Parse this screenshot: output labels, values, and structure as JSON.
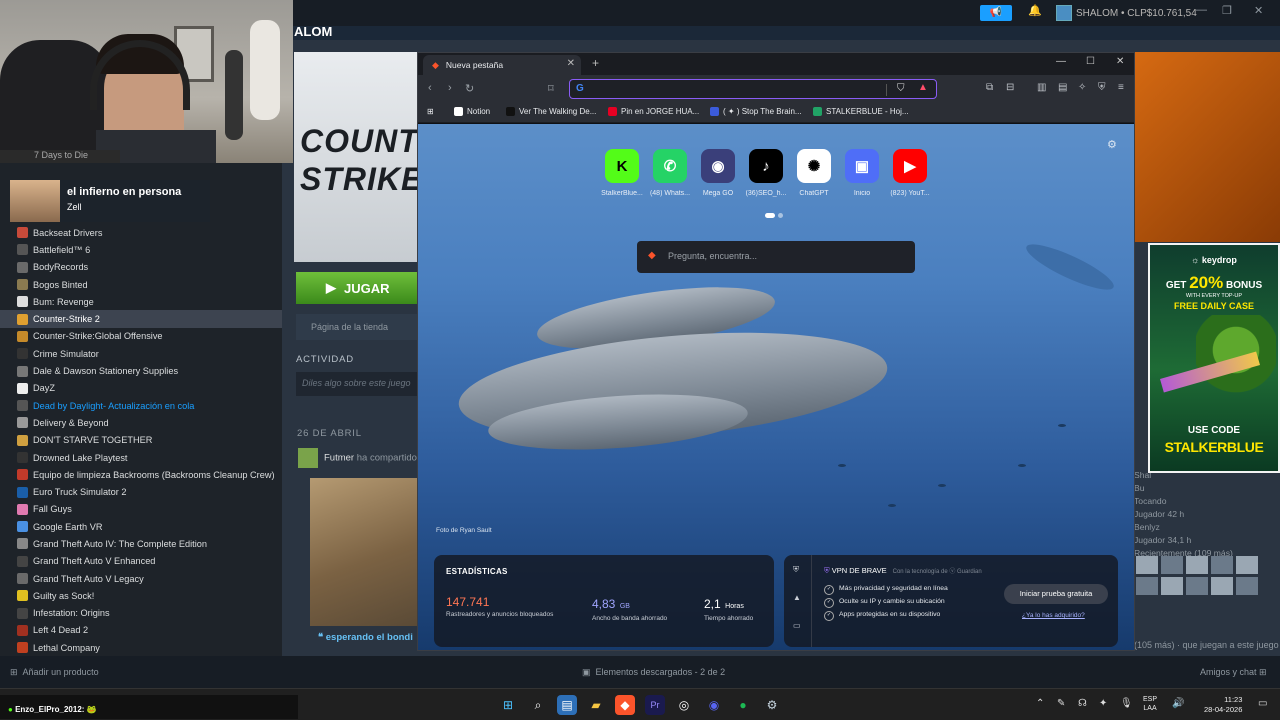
{
  "steam": {
    "game_title": "ALOM",
    "account": "SHALOM • CLP$10.761,54",
    "hero_logo": "COUNTER-STRIKE",
    "play_label": "JUGAR",
    "store_page": "Página de la tienda",
    "activity_heading": "ACTIVIDAD",
    "activity_placeholder": "Diles algo sobre este juego",
    "date_heading": "26 DE ABRIL",
    "feed_user": "Futmer",
    "feed_text": "ha compartido",
    "waiting_text": "esperando el bondi",
    "games": [
      {
        "name": "Backseat Drivers",
        "color": "#c74a3a"
      },
      {
        "name": "Battlefield™ 6",
        "color": "#555"
      },
      {
        "name": "BodyRecords",
        "color": "#6a6a6a"
      },
      {
        "name": "Bogos Binted",
        "color": "#8a7a50"
      },
      {
        "name": "Bum: Revenge",
        "color": "#ddd"
      },
      {
        "name": "Counter-Strike 2",
        "color": "#e0a030",
        "selected": true
      },
      {
        "name": "Counter-Strike:Global Offensive",
        "color": "#c58a2a"
      },
      {
        "name": "Crime Simulator",
        "color": "#333"
      },
      {
        "name": "Dale & Dawson Stationery Supplies",
        "color": "#777"
      },
      {
        "name": "DayZ",
        "color": "#eee"
      },
      {
        "name": "Dead by Daylight",
        "color": "#555",
        "update": " - Actualización en cola"
      },
      {
        "name": "Delivery & Beyond",
        "color": "#999"
      },
      {
        "name": "DON'T STARVE TOGETHER",
        "color": "#d0a040"
      },
      {
        "name": "Drowned Lake Playtest",
        "color": "#333"
      },
      {
        "name": "Equipo de limpieza Backrooms (Backrooms Cleanup Crew)",
        "color": "#c23a2a"
      },
      {
        "name": "Euro Truck Simulator 2",
        "color": "#1a5ea8"
      },
      {
        "name": "Fall Guys",
        "color": "#e07ab0"
      },
      {
        "name": "Google Earth VR",
        "color": "#4a90e2"
      },
      {
        "name": "Grand Theft Auto IV: The Complete Edition",
        "color": "#888"
      },
      {
        "name": "Grand Theft Auto V Enhanced",
        "color": "#444"
      },
      {
        "name": "Grand Theft Auto V Legacy",
        "color": "#6a6a6a"
      },
      {
        "name": "Guilty as Sock!",
        "color": "#e0c020"
      },
      {
        "name": "Infestation: Origins",
        "color": "#444"
      },
      {
        "name": "Left 4 Dead 2",
        "color": "#a03020"
      },
      {
        "name": "Lethal Company",
        "color": "#c04020"
      }
    ],
    "right_col": [
      "Shal",
      "Bu",
      "Tocando",
      "Jugador 42 h",
      "Benlyz",
      "Jugador 34,1 h",
      "Recientemente (109 más)"
    ],
    "recent_more": "(105 más)",
    "playing_text": "que juegan a este juego",
    "add_product": "Añadir un producto",
    "downloads": "Elementos descargados - 2 de 2",
    "friends_chat": "Amigos y chat"
  },
  "stream": {
    "alert_title": "el infierno en persona",
    "alert_user": "Zell",
    "cam_label": "7 Days to Die"
  },
  "browser": {
    "tab_title": "Nueva pestaña",
    "url_value": "",
    "bookmarks": [
      {
        "label": "Notion",
        "color": "#fff"
      },
      {
        "label": "Ver The Walking De...",
        "color": "#111"
      },
      {
        "label": "Pin en JORGE HUA...",
        "color": "#e60023"
      },
      {
        "label": "( ✦ ) Stop The Brain...",
        "color": "#3b5bdb"
      },
      {
        "label": "STALKERBLUE - Hoj...",
        "color": "#21a366"
      }
    ],
    "top_sites": [
      {
        "label": "StalkerBlue...",
        "icon": "K",
        "bg": "#53fc18",
        "fg": "#000"
      },
      {
        "label": "(48) Whats...",
        "icon": "✆",
        "bg": "#25d366",
        "fg": "#fff"
      },
      {
        "label": "Mega GO",
        "icon": "◉",
        "bg": "#3a3f7a",
        "fg": "#fff"
      },
      {
        "label": "(36)SEO_h...",
        "icon": "♪",
        "bg": "#000",
        "fg": "#fff"
      },
      {
        "label": "ChatGPT",
        "icon": "✺",
        "bg": "#fff",
        "fg": "#000"
      },
      {
        "label": "Inicio",
        "icon": "▣",
        "bg": "#4f6ef7",
        "fg": "#fff"
      },
      {
        "label": "(823) YouT...",
        "icon": "▶",
        "bg": "#ff0000",
        "fg": "#fff"
      }
    ],
    "search_placeholder": "Pregunta, encuentra...",
    "photo_credit": "Foto de Ryan Sault",
    "stats": {
      "heading": "ESTADÍSTICAS",
      "trackers": "147.741",
      "trackers_desc": "Rastreadores y anuncios bloqueados",
      "bandwidth": "4,83",
      "bandwidth_unit": "GB",
      "bandwidth_desc": "Ancho de banda ahorrado",
      "time": "2,1",
      "time_unit": "Horas",
      "time_desc": "Tiempo ahorrado"
    },
    "vpn": {
      "title": "VPN DE BRAVE",
      "powered": "Con la tecnología de ⓥ Guardian",
      "features": [
        "Más privacidad y seguridad en línea",
        "Oculte su IP y cambie su ubicación",
        "Apps protegidas en su dispositivo"
      ],
      "trial_button": "Iniciar prueba gratuita",
      "already_have": "¿Ya lo has adquirido?"
    }
  },
  "ad": {
    "brand": "☼ keydrop",
    "line1_pre": "GET ",
    "line1_big": "20%",
    "line1_post": " BONUS",
    "line2": "WITH EVERY TOP-UP",
    "line3": "FREE DAILY CASE",
    "use_code": "USE CODE",
    "code": "STALKERBLUE"
  },
  "taskbar": {
    "chat_user": "Enzo_ElPro_2012",
    "chat_msg": ": 🐸",
    "lang_top": "ESP",
    "lang_bottom": "LAA",
    "time": "11:23",
    "date": "28-04-2026"
  }
}
